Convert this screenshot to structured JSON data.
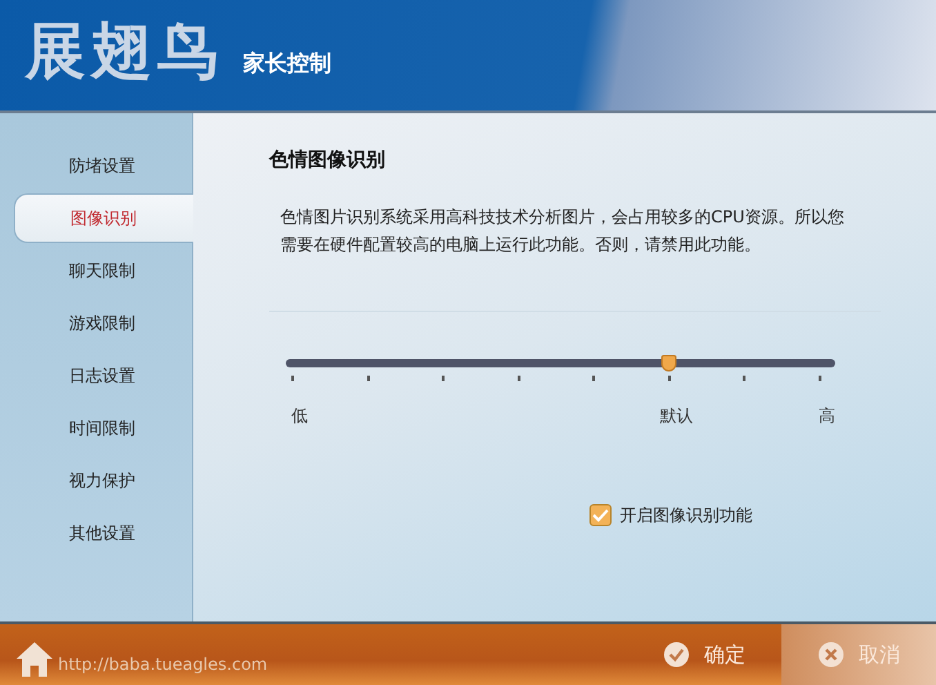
{
  "header": {
    "logo": "展翅鸟",
    "subtitle": "家长控制"
  },
  "sidebar": {
    "items": [
      {
        "label": "防堵设置",
        "selected": false
      },
      {
        "label": "图像识别",
        "selected": true
      },
      {
        "label": "聊天限制",
        "selected": false
      },
      {
        "label": "游戏限制",
        "selected": false
      },
      {
        "label": "日志设置",
        "selected": false
      },
      {
        "label": "时间限制",
        "selected": false
      },
      {
        "label": "视力保护",
        "selected": false
      },
      {
        "label": "其他设置",
        "selected": false
      }
    ]
  },
  "content": {
    "title": "色情图像识别",
    "description": "色情图片识别系统采用高科技技术分析图片，会占用较多的CPU资源。所以您需要在硬件配置较高的电脑上运行此功能。否则，请禁用此功能。",
    "slider": {
      "level": 0.714,
      "labels": [
        "低",
        "默认",
        "高"
      ]
    },
    "checkbox": {
      "label": "开启图像识别功能",
      "checked": true
    }
  },
  "footer": {
    "url": "http://baba.tueagles.com",
    "buttons": [
      {
        "label": "确定",
        "kind": "ok"
      },
      {
        "label": "取消",
        "kind": "cancel"
      }
    ]
  }
}
